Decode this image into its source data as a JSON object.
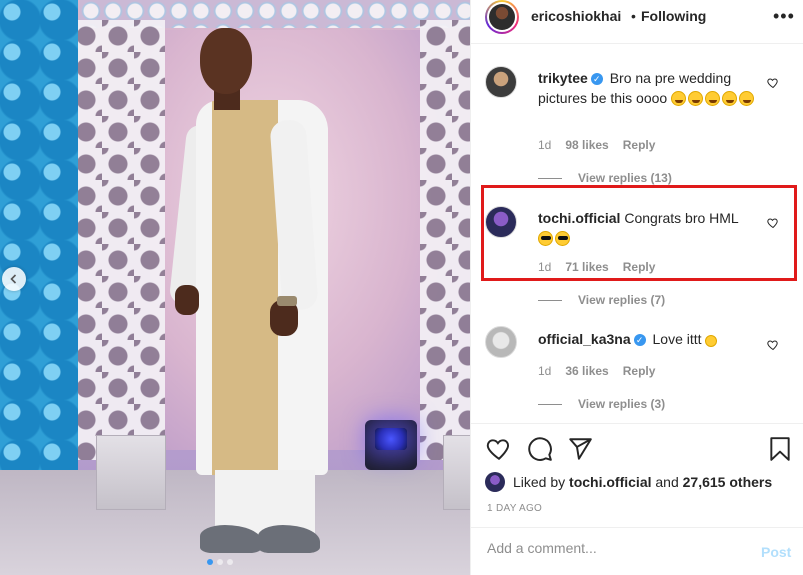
{
  "post": {
    "username": "ericoshiokhai",
    "separator": "•",
    "following_label": "Following",
    "more_label": "•••",
    "carousel_dots": 3,
    "active_dot": 0
  },
  "comments": [
    {
      "username": "trikytee",
      "verified": true,
      "text": "Bro na pre wedding pictures be this oooo",
      "emojis": [
        "rolling-laughing",
        "rolling-laughing",
        "rolling-laughing",
        "rolling-laughing",
        "rolling-laughing"
      ],
      "age": "1d",
      "likes": "98 likes",
      "reply": "Reply",
      "view_replies": "View replies (13)"
    },
    {
      "username": "tochi.official",
      "verified": false,
      "text": "Congrats bro HML",
      "emojis": [
        "sunglasses",
        "sunglasses"
      ],
      "age": "1d",
      "likes": "71 likes",
      "reply": "Reply",
      "view_replies": "View replies (7)"
    },
    {
      "username": "official_ka3na",
      "verified": true,
      "text": "Love ittt",
      "emojis": [
        "smiling-face"
      ],
      "age": "1d",
      "likes": "36 likes",
      "reply": "Reply",
      "view_replies": "View replies (3)"
    }
  ],
  "likes_summary": {
    "prefix": "Liked by",
    "user": "tochi.official",
    "conjunction": "and",
    "others": "27,615 others"
  },
  "time_ago": "1 DAY AGO",
  "add_comment": {
    "placeholder": "Add a comment...",
    "post_label": "Post"
  },
  "colors": {
    "highlight": "#e01a1a",
    "verified": "#3897f0",
    "post_disabled": "#b2dffc"
  }
}
